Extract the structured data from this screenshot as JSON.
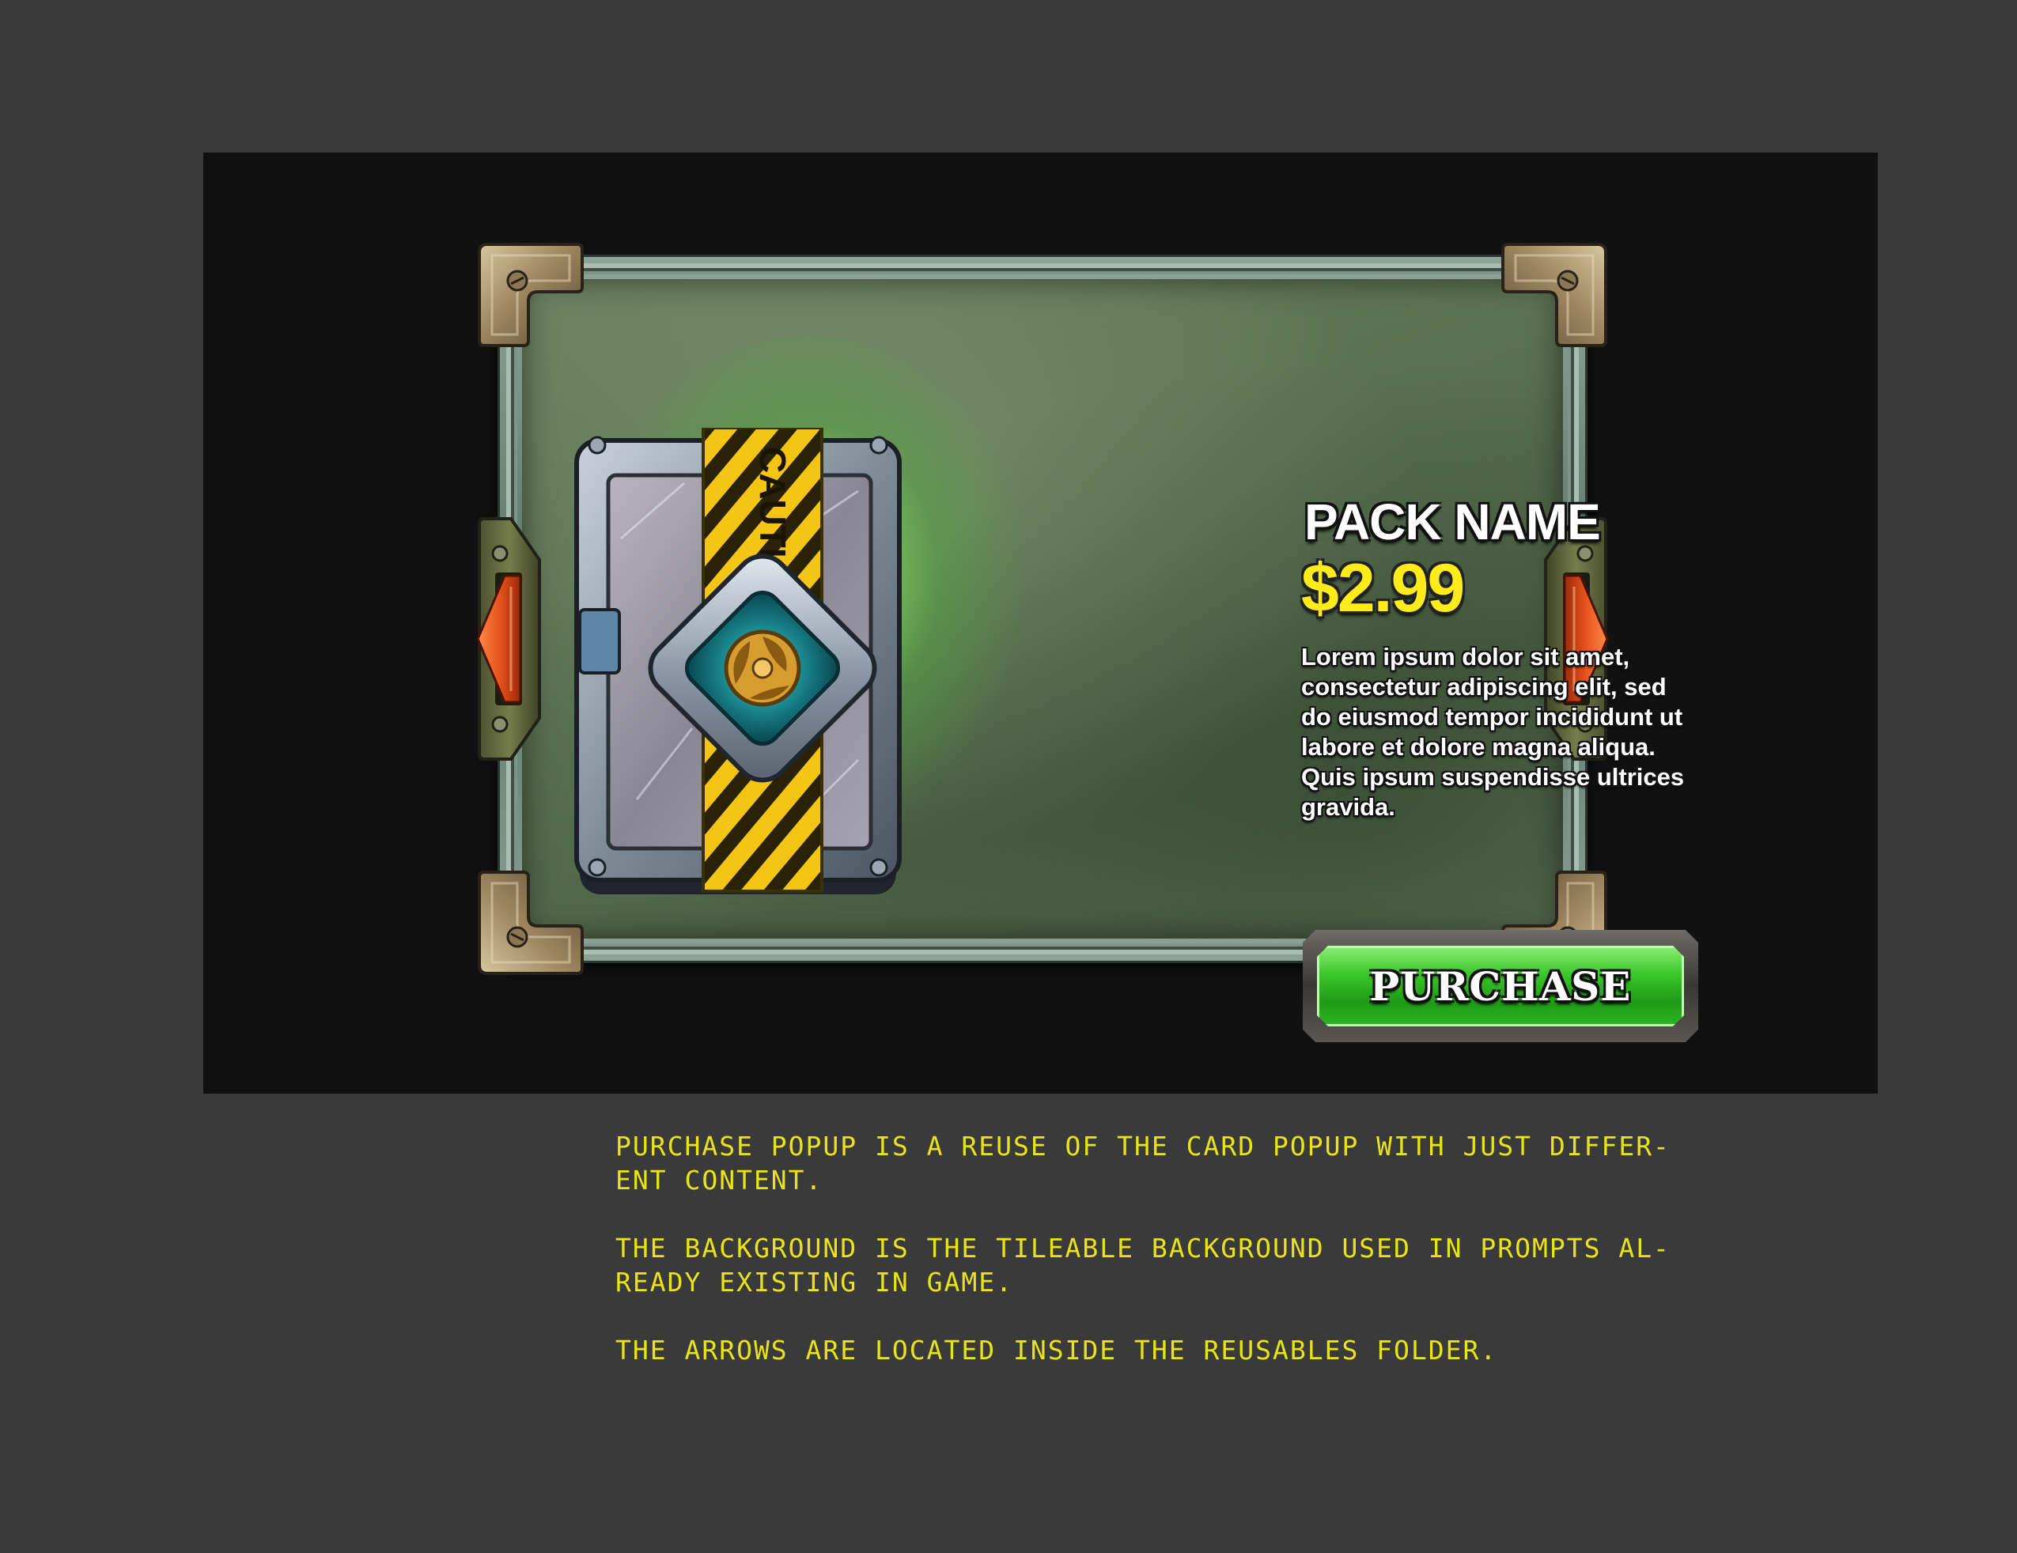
{
  "popup": {
    "pack_name": "PACK NAME",
    "price": "$2.99",
    "description": "Lorem ipsum dolor sit amet, consectetur adipiscing elit, sed do eiusmod tempor incididunt ut labore et dolore magna aliqua. Quis ipsum suspendisse ultrices gravida.",
    "purchase_label": "PURCHASE",
    "pack_tape_text": "CAUTION!",
    "nav": {
      "left_icon": "chevron-left-icon",
      "right_icon": "chevron-right-icon"
    }
  },
  "notes": [
    "PURCHASE POPUP IS A REUSE OF THE CARD POPUP WITH JUST DIFFER-\nENT CONTENT.",
    "THE BACKGROUND IS THE TILEABLE BACKGROUND USED IN PROMPTS AL-\nREADY EXISTING IN GAME.",
    "THE ARROWS ARE LOCATED INSIDE THE REUSABLES FOLDER."
  ],
  "colors": {
    "page_background": "#3b3a3b",
    "screen_background": "#111111",
    "price": "#ffec1a",
    "purchase_green": "#3cc72a",
    "arrow_orange": "#e8531e",
    "notes_text": "#e9e31c"
  }
}
